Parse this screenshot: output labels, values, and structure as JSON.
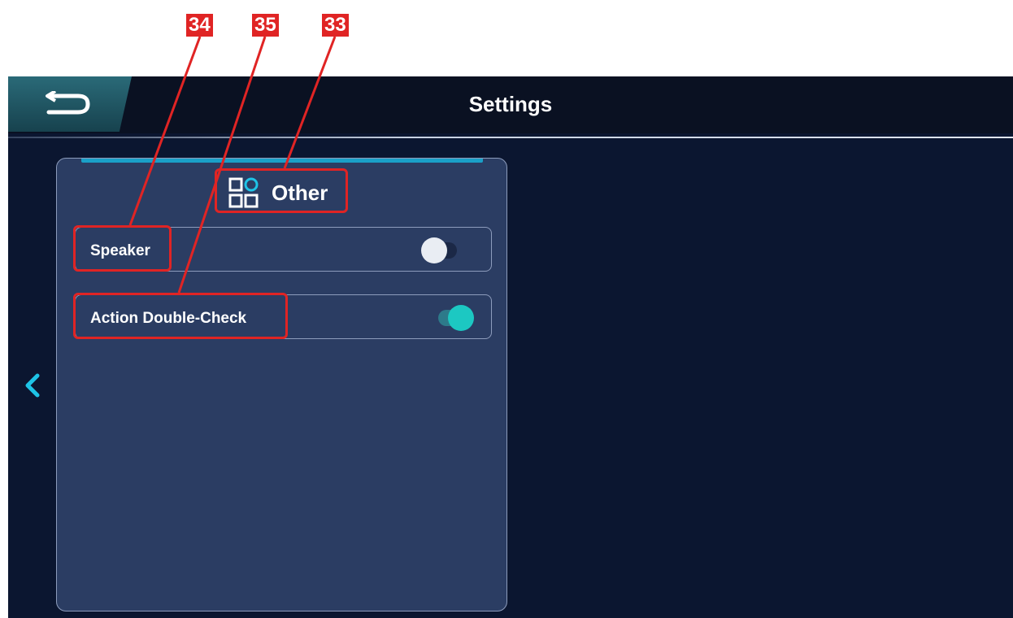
{
  "app": {
    "title": "Settings"
  },
  "panel": {
    "header": {
      "title": "Other",
      "icon": "grid-apps-icon"
    },
    "settings": [
      {
        "label": "Speaker",
        "toggle_state": "off"
      },
      {
        "label": "Action Double-Check",
        "toggle_state": "on"
      }
    ]
  },
  "annotations": {
    "labels": [
      "34",
      "35",
      "33"
    ]
  },
  "colors": {
    "background": "#0b1630",
    "titlebar": "#0a1122",
    "panel": "#2b3d63",
    "accent": "#1aa0c8",
    "toggle_on": "#1cc8c2",
    "annotation": "#e02424"
  }
}
